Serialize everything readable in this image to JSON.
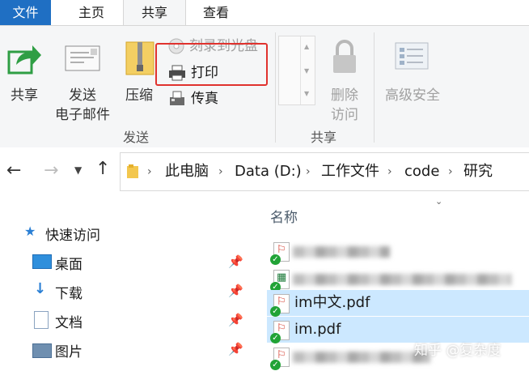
{
  "tabs": {
    "file": "文件",
    "home": "主页",
    "share": "共享",
    "view": "查看"
  },
  "ribbon": {
    "share_btn": "共享",
    "email_line1": "发送",
    "email_line2": "电子邮件",
    "zip": "压缩",
    "burn": "刻录到光盘",
    "print": "打印",
    "fax": "传真",
    "send_group": "发送",
    "remove_access_line1": "删除",
    "remove_access_line2": "访问",
    "advanced_security": "高级安全",
    "share_group": "共享"
  },
  "address": {
    "crumbs": [
      "此电脑",
      "Data (D:)",
      "工作文件",
      "code",
      "研究"
    ]
  },
  "nav": {
    "quick_access": "快速访问",
    "items": [
      "桌面",
      "下载",
      "文档",
      "图片"
    ]
  },
  "files": {
    "column_name": "名称",
    "names": [
      "im中文.pdf",
      "im.pdf"
    ]
  },
  "watermark": "知乎 @复杂度",
  "colors": {
    "accent": "#1f6fc3",
    "selection": "#cce8ff",
    "highlight": "#e0322e"
  }
}
